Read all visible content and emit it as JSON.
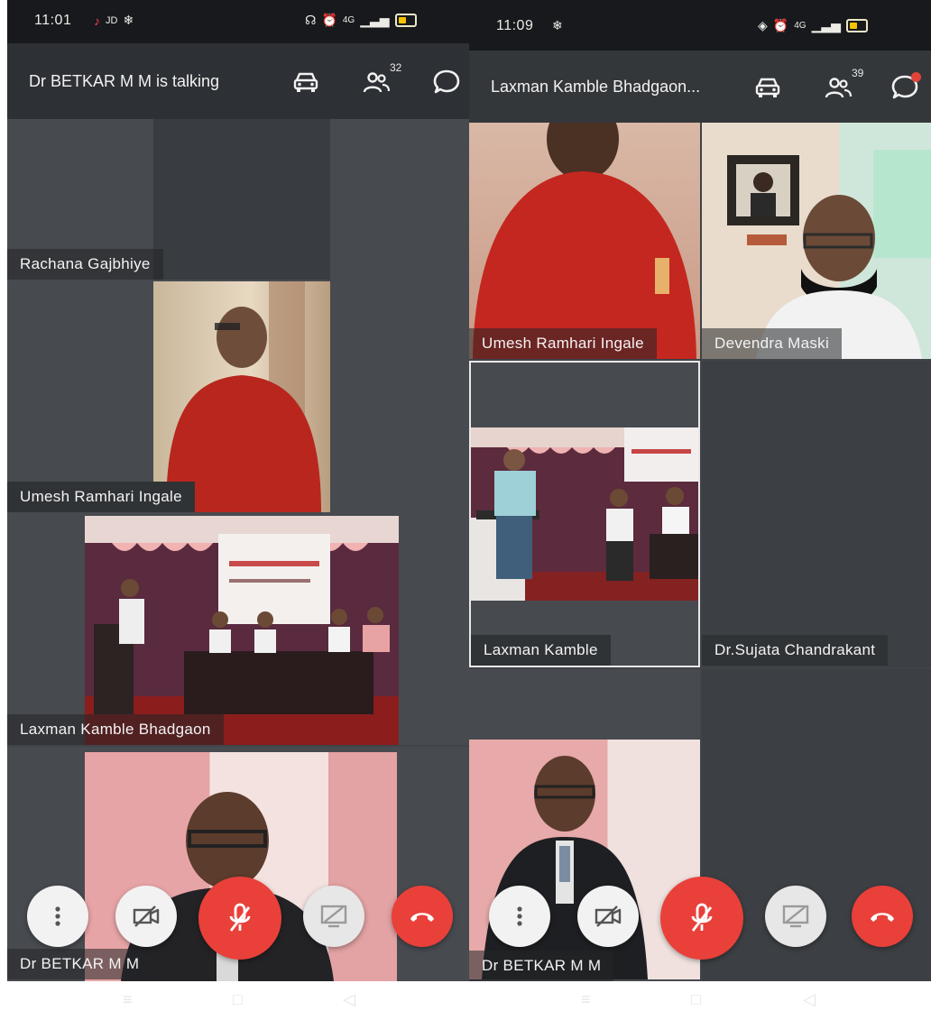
{
  "left": {
    "status": {
      "time": "11:01",
      "signal": "JD",
      "net": "4G"
    },
    "header": {
      "title": "Dr BETKAR M M is talking",
      "participants": "32"
    },
    "tiles": [
      {
        "name": "Rachana Gajbhiye"
      },
      {
        "name": "Umesh Ramhari Ingale"
      },
      {
        "name": "Laxman Kamble Bhadgaon"
      },
      {
        "name": "Dr BETKAR M M"
      }
    ]
  },
  "right": {
    "status": {
      "time": "11:09",
      "net": "4G"
    },
    "header": {
      "title": "Laxman Kamble Bhadgaon...",
      "participants": "39"
    },
    "tiles": [
      {
        "name": "Umesh Ramhari Ingale"
      },
      {
        "name": "Devendra Maski"
      },
      {
        "name": "Laxman Kamble"
      },
      {
        "name": "Dr.Sujata Chandrakant"
      },
      {
        "name": "Dr BETKAR M M"
      }
    ]
  },
  "icons": {
    "more": "more-vertical-icon",
    "camera": "camera-off-icon",
    "mic": "mic-off-icon",
    "screen": "screen-share-off-icon",
    "hangup": "phone-hangup-icon",
    "car": "car-mode-icon",
    "people": "participants-icon",
    "chat": "chat-icon"
  },
  "colors": {
    "accent_red": "#e9403a",
    "background": "#404348",
    "topbar": "#2d3034",
    "statusbar": "#17191c"
  }
}
